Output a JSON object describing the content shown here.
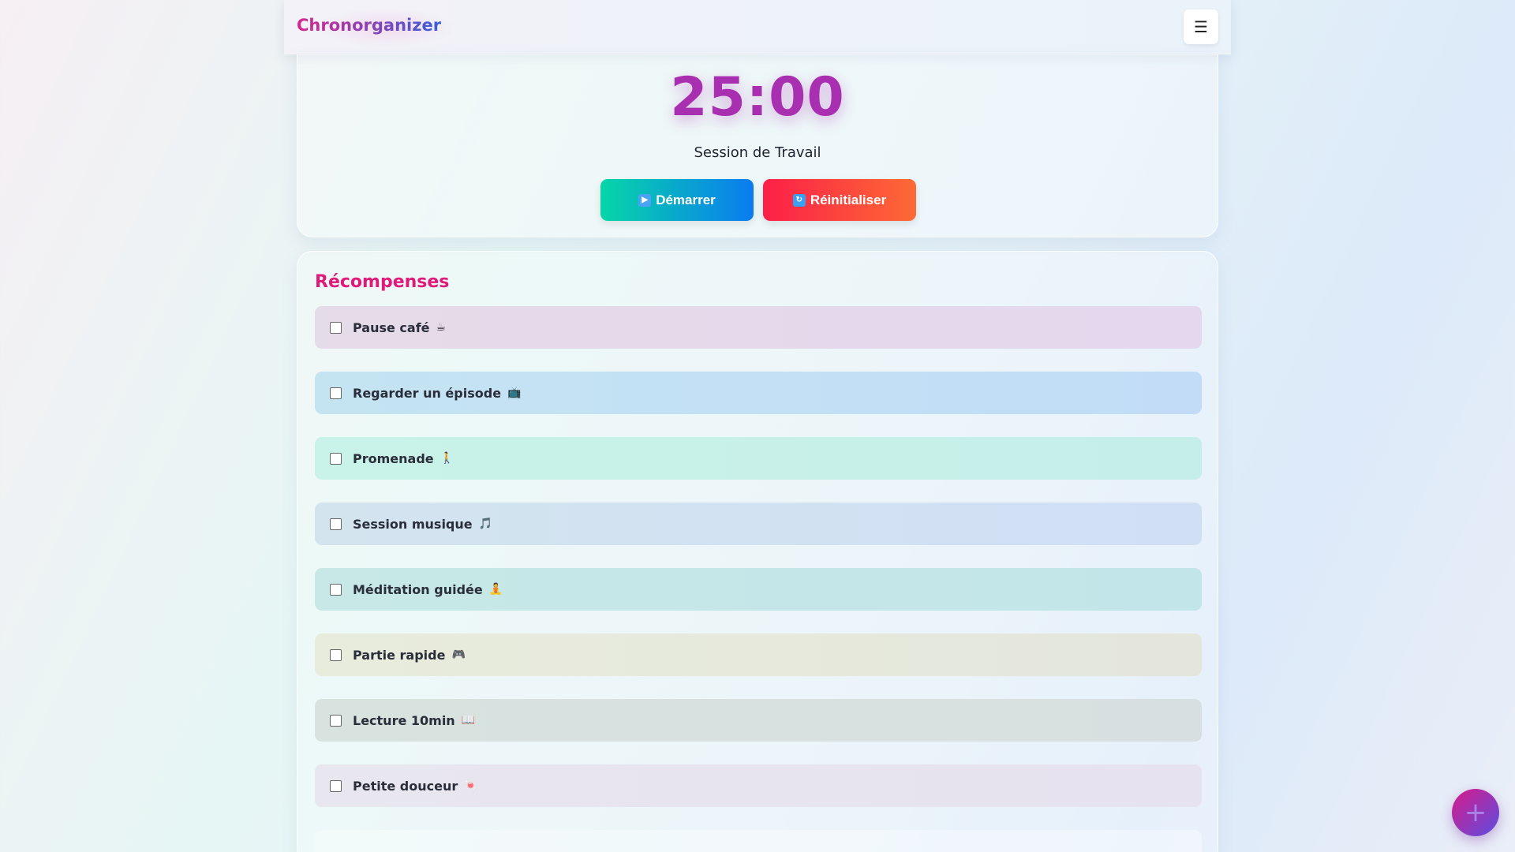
{
  "header": {
    "brand": "Chronorganizer",
    "menu_icon": "☰"
  },
  "timer": {
    "display": "25:00",
    "session_label": "Session de Travail",
    "start_label": "Démarrer",
    "start_icon": "▶",
    "reset_label": "Réinitialiser",
    "reset_icon": "↻"
  },
  "rewards": {
    "title": "Récompenses",
    "items": [
      {
        "label": "Pause café",
        "emoji": "☕",
        "checked": false
      },
      {
        "label": "Regarder un épisode",
        "emoji": "📺",
        "checked": false
      },
      {
        "label": "Promenade",
        "emoji": "🚶",
        "checked": false
      },
      {
        "label": "Session musique",
        "emoji": "🎵",
        "checked": false
      },
      {
        "label": "Méditation guidée",
        "emoji": "🧘",
        "checked": false
      },
      {
        "label": "Partie rapide",
        "emoji": "🎮",
        "checked": false
      },
      {
        "label": "Lecture 10min",
        "emoji": "📖",
        "checked": false
      },
      {
        "label": "Petite douceur",
        "emoji": "🍬",
        "checked": false
      }
    ]
  },
  "fab": {
    "icon": "+"
  },
  "colors": {
    "brand_gradient": [
      "#d8268f",
      "#3a5fd8"
    ],
    "timer": "#a82fb0",
    "rewards_title": "#e0197a",
    "start_gradient": [
      "#07d6a8",
      "#0a7bf0"
    ],
    "reset_gradient": [
      "#fc1f48",
      "#fd6a35"
    ]
  }
}
